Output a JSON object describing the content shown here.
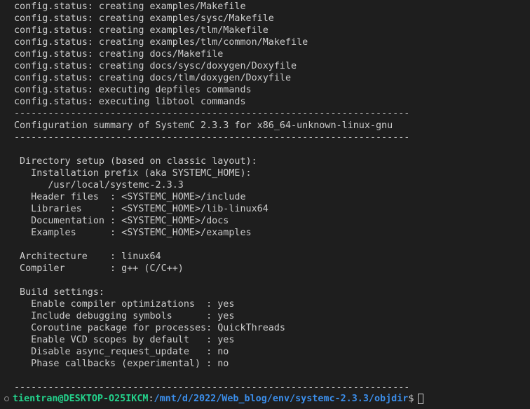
{
  "lines": [
    "config.status: creating examples/Makefile",
    "config.status: creating examples/sysc/Makefile",
    "config.status: creating examples/tlm/Makefile",
    "config.status: creating examples/tlm/common/Makefile",
    "config.status: creating docs/Makefile",
    "config.status: creating docs/sysc/doxygen/Doxyfile",
    "config.status: creating docs/tlm/doxygen/Doxyfile",
    "config.status: executing depfiles commands",
    "config.status: executing libtool commands",
    "----------------------------------------------------------------------",
    "Configuration summary of SystemC 2.3.3 for x86_64-unknown-linux-gnu",
    "----------------------------------------------------------------------",
    "",
    " Directory setup (based on classic layout):",
    "   Installation prefix (aka SYSTEMC_HOME):",
    "      /usr/local/systemc-2.3.3",
    "   Header files  : <SYSTEMC_HOME>/include",
    "   Libraries     : <SYSTEMC_HOME>/lib-linux64",
    "   Documentation : <SYSTEMC_HOME>/docs",
    "   Examples      : <SYSTEMC_HOME>/examples",
    "",
    " Architecture    : linux64",
    " Compiler        : g++ (C/C++)",
    "",
    " Build settings:",
    "   Enable compiler optimizations  : yes",
    "   Include debugging symbols      : yes",
    "   Coroutine package for processes: QuickThreads",
    "   Enable VCD scopes by default   : yes",
    "   Disable async_request_update   : no",
    "   Phase callbacks (experimental) : no",
    "",
    "----------------------------------------------------------------------"
  ],
  "prompt": {
    "user_host": "tientran@DESKTOP-O25IKCM",
    "colon": ":",
    "path": "/mnt/d/2022/Web_blog/env/systemc-2.3.3/objdir",
    "symbol": "$"
  },
  "colors": {
    "background": "#1e1e1e",
    "foreground": "#cccccc",
    "user_host": "#23d18b",
    "path": "#3b8eea"
  }
}
